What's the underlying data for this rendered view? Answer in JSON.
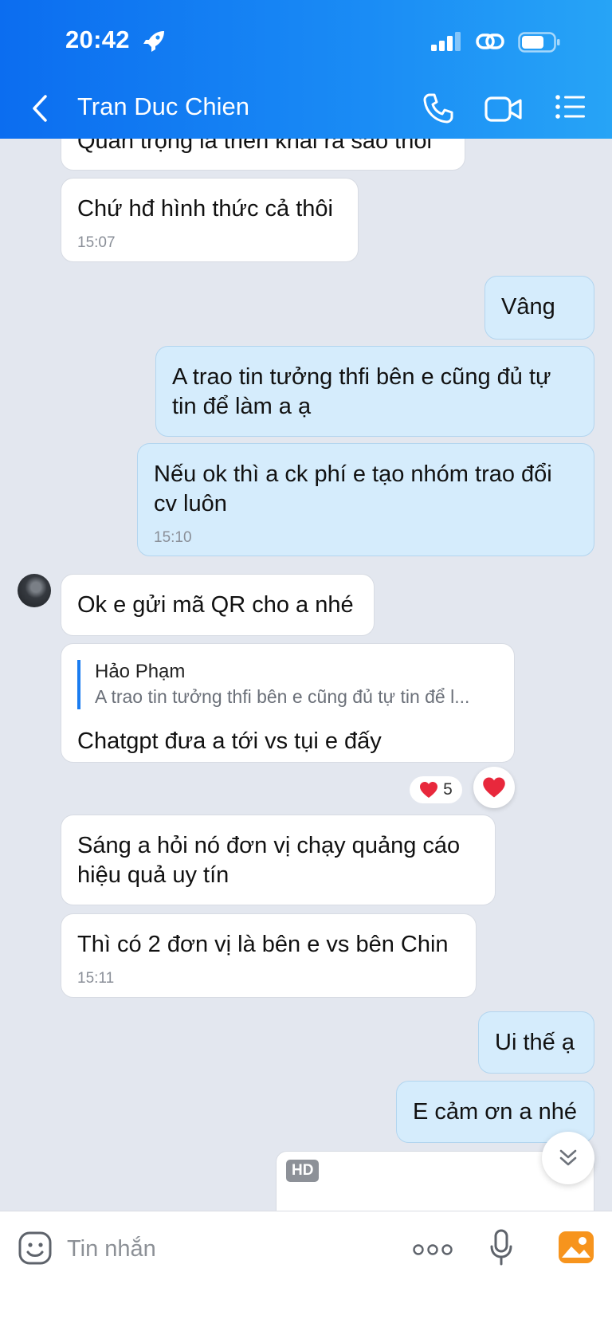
{
  "status_bar": {
    "time": "20:42"
  },
  "header": {
    "contact_name": "Tran Duc Chien"
  },
  "messages": [
    {
      "text": "Quan trọng là triển khai ra sao thôi"
    },
    {
      "text": "Chứ hđ hình thức cả thôi",
      "time": "15:07"
    },
    {
      "text": "Vâng"
    },
    {
      "text": "A trao tin tưởng thfi bên e cũng đủ tự tin để làm a ạ"
    },
    {
      "text": "Nếu ok thì a ck phí e tạo nhóm trao đổi cv luôn",
      "time": "15:10"
    },
    {
      "text": "Ok e gửi mã QR cho a nhé"
    },
    {
      "quote_name": "Hảo Phạm",
      "quote_text": "A trao tin tưởng thfi bên e cũng đủ tự tin để l...",
      "text": "Chatgpt đưa a tới vs tụi e đấy",
      "reaction_count": "5"
    },
    {
      "text": "Sáng a hỏi nó đơn vị chạy quảng cáo hiệu quả uy tín"
    },
    {
      "text": "Thì có 2 đơn vị là bên e vs bên Chin",
      "time": "15:11"
    },
    {
      "text": "Ui thế ạ"
    },
    {
      "text": "E cảm ơn a nhé"
    },
    {
      "badge": "HD"
    }
  ],
  "composer": {
    "placeholder": "Tin nhắn"
  },
  "colors": {
    "header_accent": "#1a8cf5",
    "outgoing_bubble": "#d5ecfc",
    "incoming_bubble": "#ffffff",
    "background": "#e3e7ef",
    "heart": "#e8283c",
    "gallery_orange": "#f7941d"
  }
}
